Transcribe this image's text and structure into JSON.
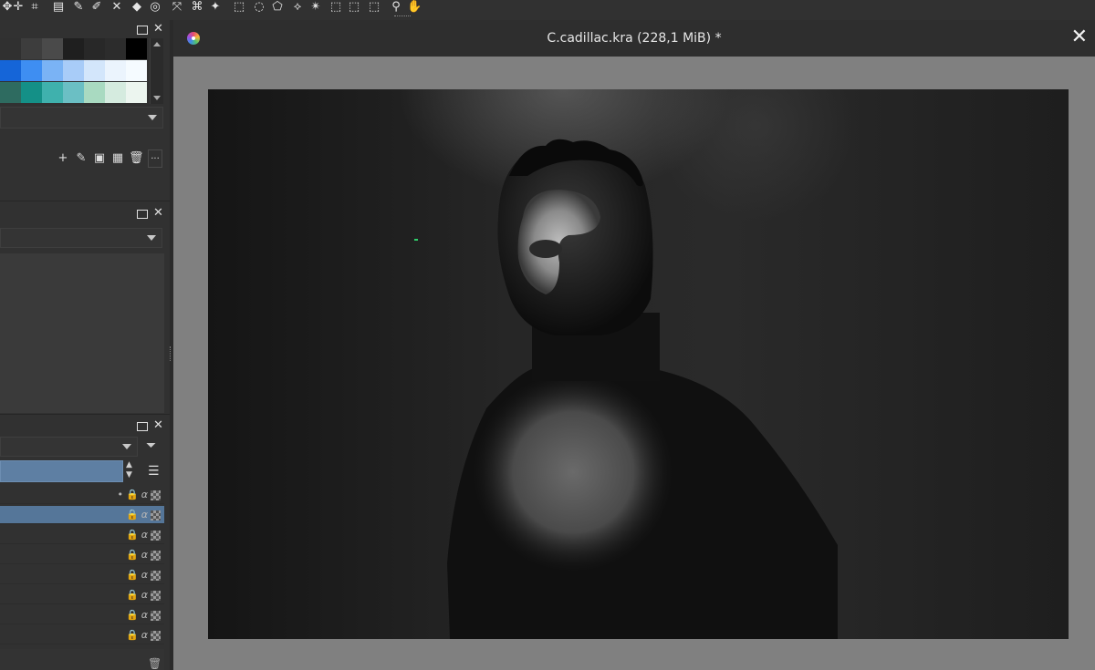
{
  "document": {
    "title": "C.cadillac.kra (228,1 MiB) *",
    "close_glyph": "✕"
  },
  "toolbar": {
    "tools": [
      "contiguous-fill-icon",
      "move-icon",
      "crop-icon",
      "gradient-icon",
      "color-picker-icon",
      "smart-patch-icon",
      "fill-icon",
      "enclose-fill-icon",
      "transform-icon",
      "assistant-icon",
      "reference-icon",
      "rect-select-icon",
      "ellipse-select-icon",
      "polygon-select-icon",
      "freehand-select-icon",
      "contiguous-select-icon",
      "similar-select-icon",
      "bezier-select-icon",
      "magnetic-select-icon",
      "zoom-icon",
      "pan-icon"
    ]
  },
  "palette": {
    "colors_row1": [
      "#303030",
      "#3d3d3d",
      "#4a4a4a",
      "#1f1f1f",
      "#282828",
      "#2c2c2c",
      "#000000"
    ],
    "colors_row2": [
      "#1565d8",
      "#3e8ef2",
      "#7ab3f5",
      "#a8ccf8",
      "#d3e6fb",
      "#ebf4fd",
      "#f5fbff"
    ],
    "colors_row3": [
      "#2e6b60",
      "#149087",
      "#3fb1ad",
      "#6bbfc4",
      "#a9dac1",
      "#d5ebdf",
      "#ecf5ef"
    ],
    "actions": [
      "add-icon",
      "edit-icon",
      "save-icon",
      "grid-icon",
      "delete-icon"
    ],
    "more_label": "..."
  },
  "layers": {
    "row_count": 8,
    "active_index": 1
  },
  "colors": {
    "accent": "#557699",
    "panel": "#313131",
    "canvas_bg": "#808080"
  }
}
